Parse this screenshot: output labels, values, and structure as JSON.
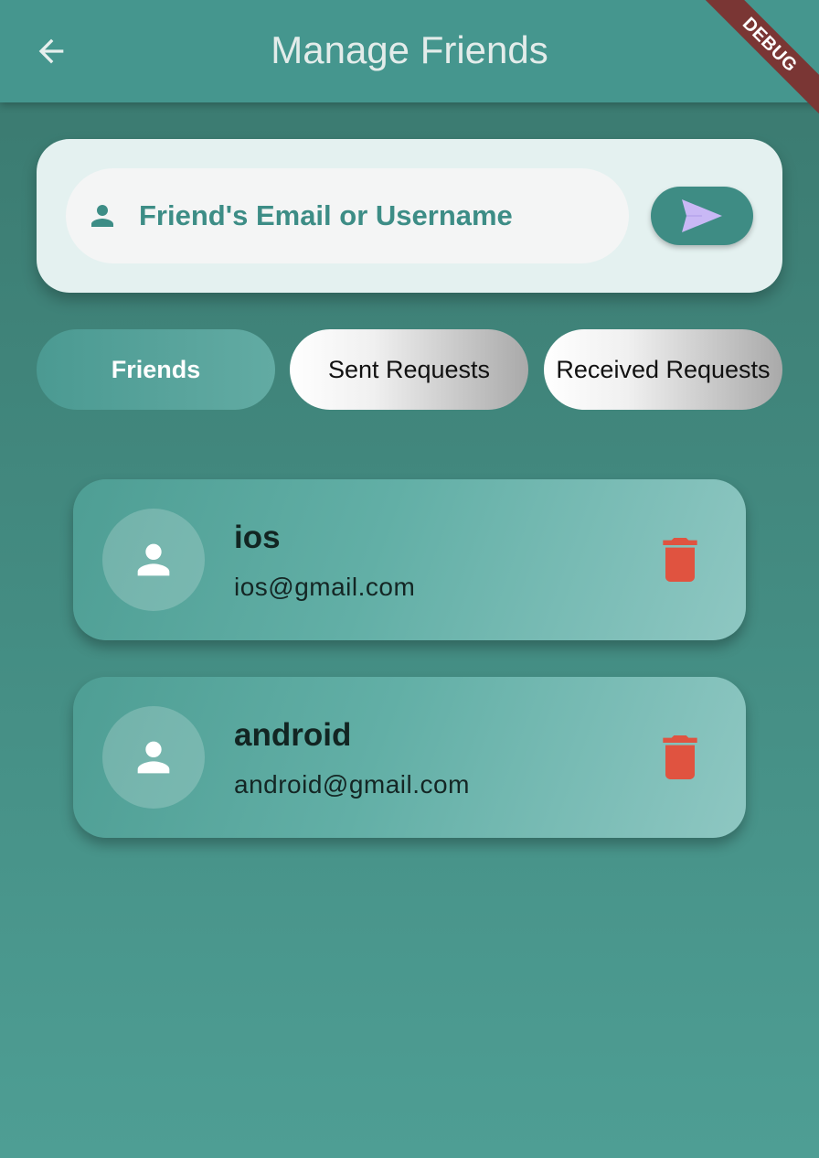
{
  "appbar": {
    "title": "Manage Friends",
    "back_icon": "arrow-left-icon",
    "debug_banner": "DEBUG"
  },
  "search": {
    "placeholder": "Friend's Email or Username",
    "value": "",
    "person_icon": "person-icon",
    "send_icon": "send-icon"
  },
  "tabs": [
    {
      "label": "Friends",
      "active": true
    },
    {
      "label": "Sent Requests",
      "active": false
    },
    {
      "label": "Received Requests",
      "active": false
    }
  ],
  "friends": [
    {
      "name": "ios",
      "email": "ios@gmail.com",
      "avatar_icon": "person-icon",
      "delete_icon": "trash-icon"
    },
    {
      "name": "android",
      "email": "android@gmail.com",
      "avatar_icon": "person-icon",
      "delete_icon": "trash-icon"
    }
  ],
  "colors": {
    "primary": "#45968e",
    "send_arrow": "#c9b8f5",
    "delete": "#e05340",
    "search_text": "#3d8d86"
  }
}
